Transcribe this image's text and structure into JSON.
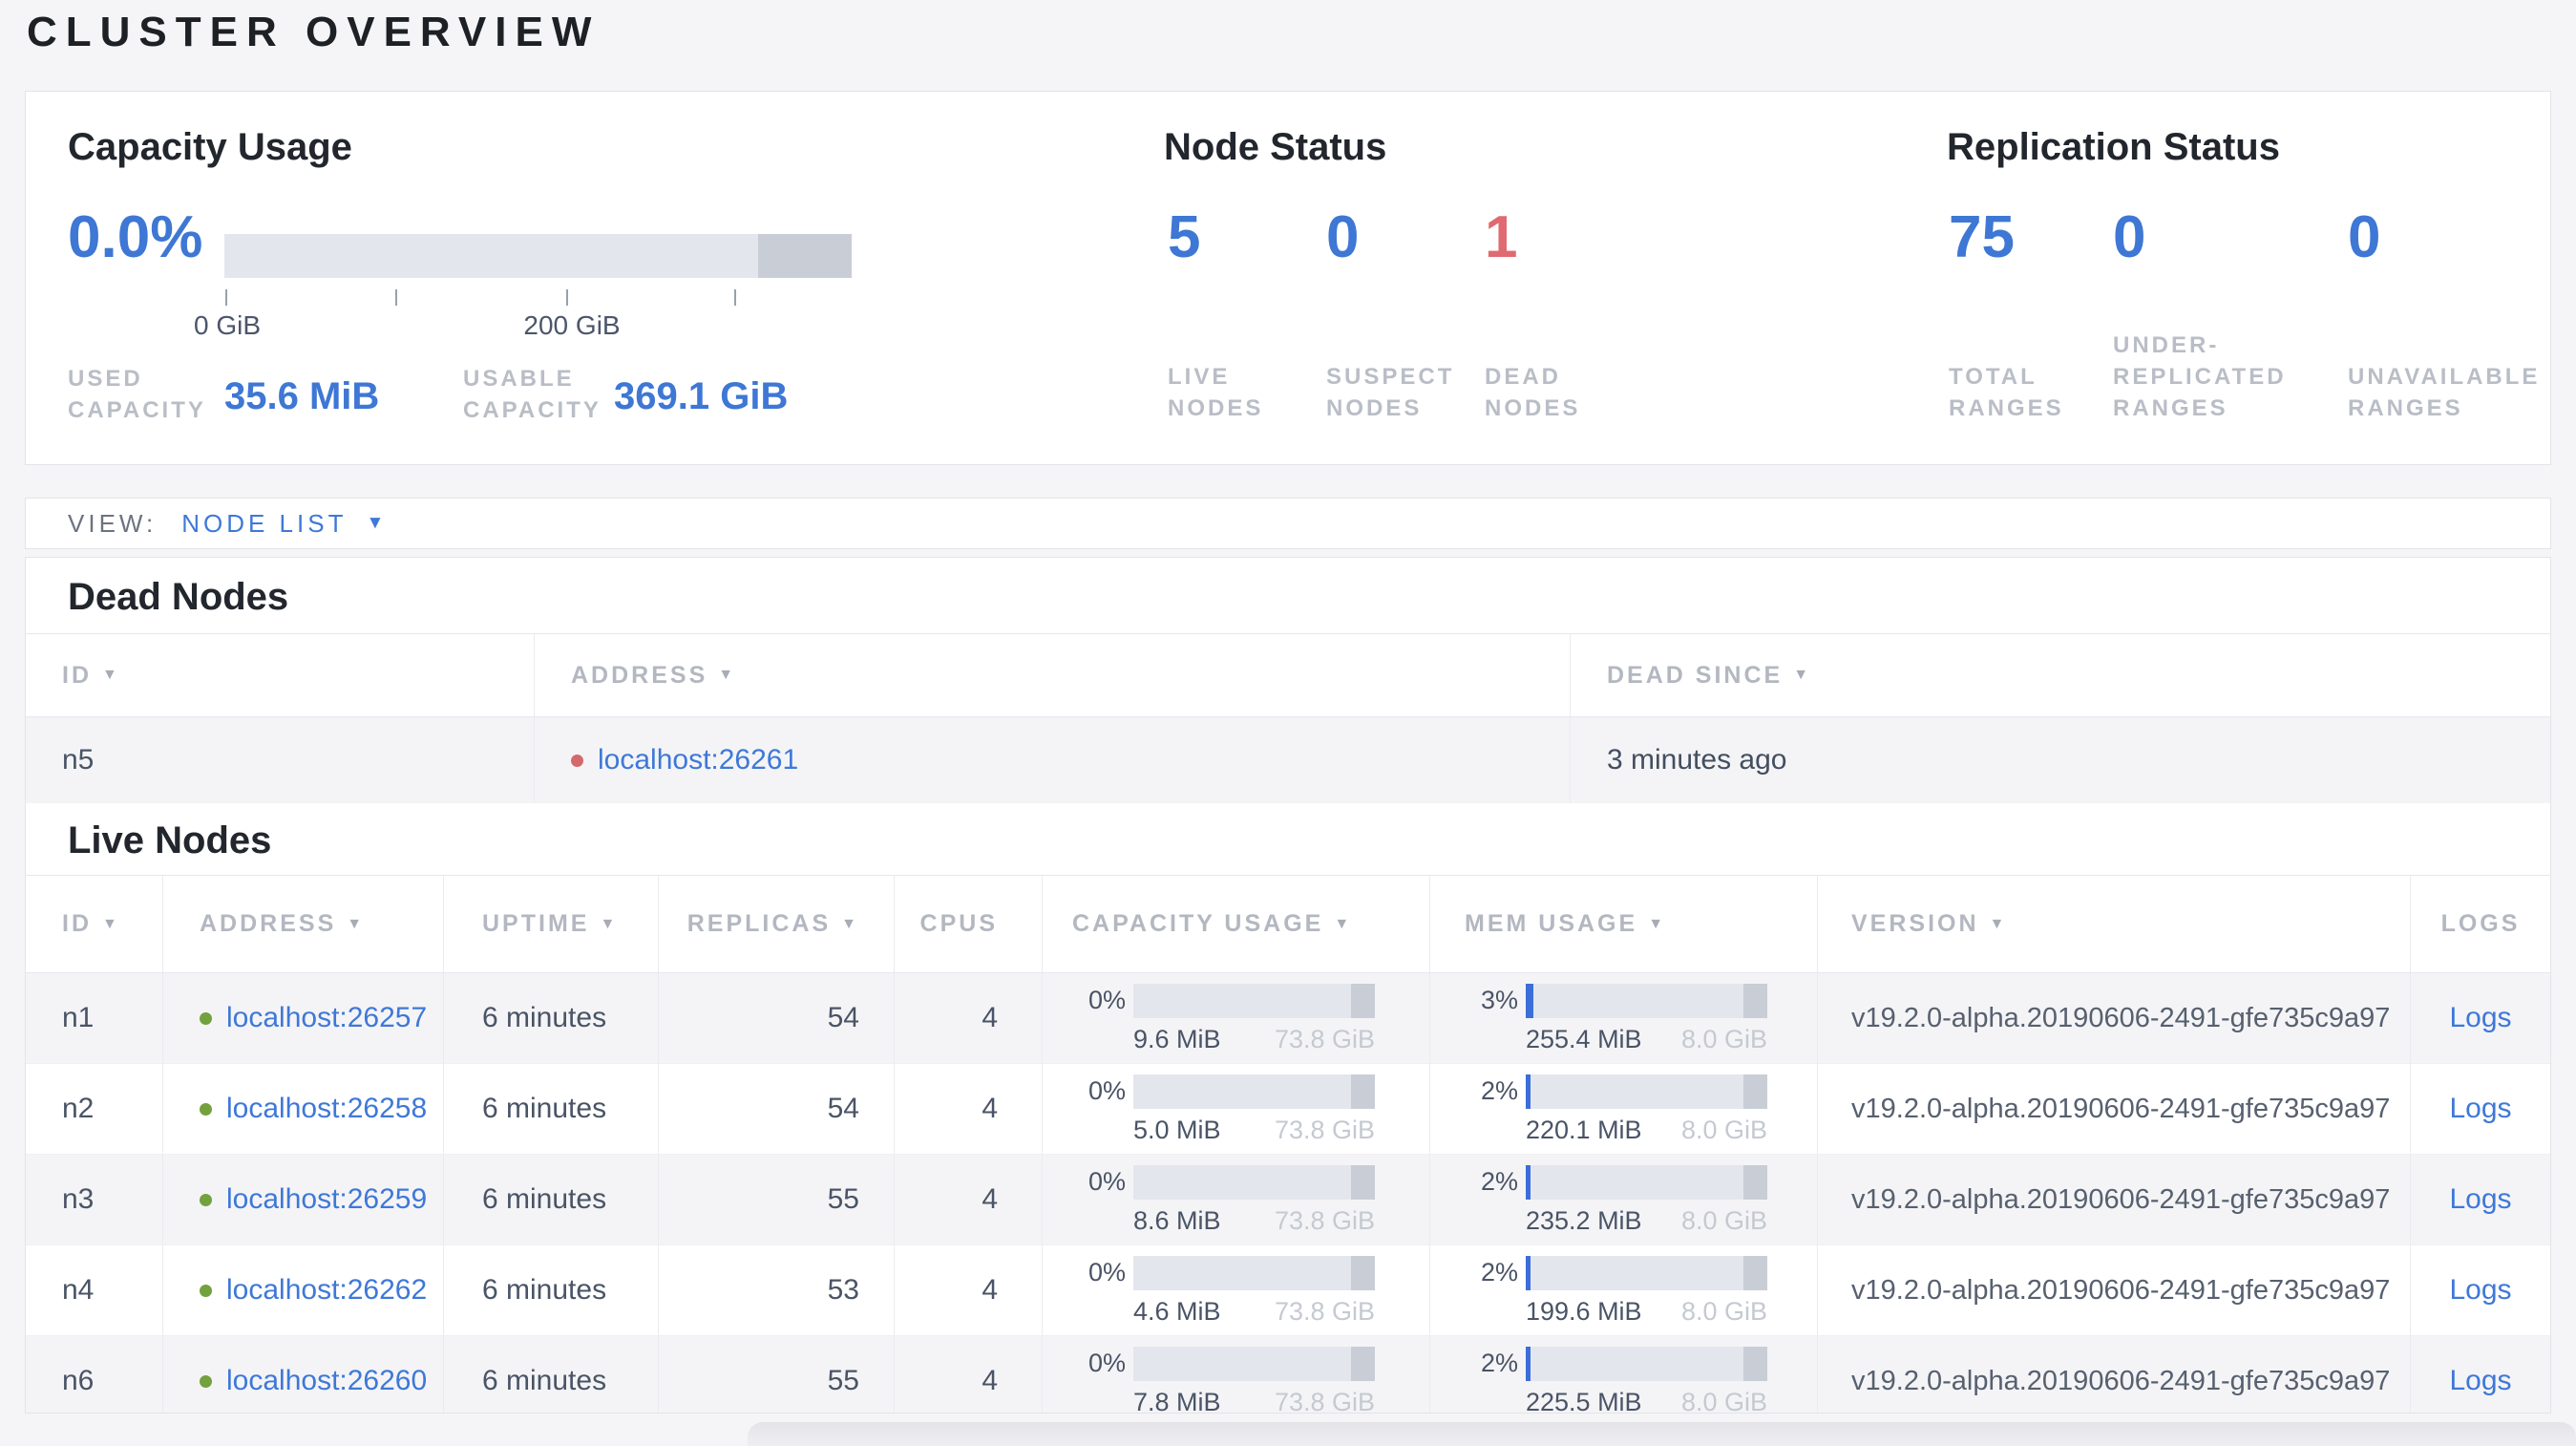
{
  "colors": {
    "accent_blue": "#3e77d4",
    "danger_red": "#e06a71",
    "live_dot_green": "#73a13d",
    "dead_dot_red": "#d4696b",
    "bar_track": "#e4e6ee",
    "bar_reserved": "#c9cdd6",
    "bar_fill_blue": "#3c6ed9"
  },
  "page_title": "CLUSTER OVERVIEW",
  "summary": {
    "capacity_usage": {
      "title": "Capacity Usage",
      "percent": "0.0%",
      "tick_labels": [
        "0 GiB",
        "200 GiB"
      ],
      "used_label": "USED CAPACITY",
      "used_value": "35.6 MiB",
      "usable_label": "USABLE CAPACITY",
      "usable_value": "369.1 GiB"
    },
    "node_status": {
      "title": "Node Status",
      "stats": [
        {
          "value": "5",
          "label": "LIVE NODES"
        },
        {
          "value": "0",
          "label": "SUSPECT NODES"
        },
        {
          "value": "1",
          "label": "DEAD NODES"
        }
      ]
    },
    "replication_status": {
      "title": "Replication Status",
      "stats": [
        {
          "value": "75",
          "label": "TOTAL RANGES"
        },
        {
          "value": "0",
          "label": "UNDER-REPLICATED RANGES"
        },
        {
          "value": "0",
          "label": "UNAVAILABLE RANGES"
        }
      ]
    }
  },
  "view_bar": {
    "label": "VIEW:",
    "selected": "NODE LIST"
  },
  "dead_nodes": {
    "title": "Dead Nodes",
    "columns": [
      {
        "label": "ID",
        "sortable": true
      },
      {
        "label": "ADDRESS",
        "sortable": true
      },
      {
        "label": "DEAD SINCE",
        "sortable": true
      }
    ],
    "rows": [
      {
        "id": "n5",
        "address": "localhost:26261",
        "dead_since": "3 minutes ago"
      }
    ]
  },
  "live_nodes": {
    "title": "Live Nodes",
    "columns": [
      {
        "label": "ID",
        "sortable": true
      },
      {
        "label": "ADDRESS",
        "sortable": true
      },
      {
        "label": "UPTIME",
        "sortable": true
      },
      {
        "label": "REPLICAS",
        "sortable": true
      },
      {
        "label": "CPUS",
        "sortable": false
      },
      {
        "label": "CAPACITY USAGE",
        "sortable": true
      },
      {
        "label": "MEM USAGE",
        "sortable": true
      },
      {
        "label": "VERSION",
        "sortable": true
      },
      {
        "label": "LOGS",
        "sortable": false
      }
    ],
    "rows": [
      {
        "id": "n1",
        "address": "localhost:26257",
        "uptime": "6 minutes",
        "replicas": "54",
        "cpus": "4",
        "capacity_pct": "0%",
        "capacity_used": "9.6 MiB",
        "capacity_total": "73.8 GiB",
        "mem_pct": "3%",
        "mem_used": "255.4 MiB",
        "mem_total": "8.0 GiB",
        "version": "v19.2.0-alpha.20190606-2491-gfe735c9a97",
        "logs": "Logs"
      },
      {
        "id": "n2",
        "address": "localhost:26258",
        "uptime": "6 minutes",
        "replicas": "54",
        "cpus": "4",
        "capacity_pct": "0%",
        "capacity_used": "5.0 MiB",
        "capacity_total": "73.8 GiB",
        "mem_pct": "2%",
        "mem_used": "220.1 MiB",
        "mem_total": "8.0 GiB",
        "version": "v19.2.0-alpha.20190606-2491-gfe735c9a97",
        "logs": "Logs"
      },
      {
        "id": "n3",
        "address": "localhost:26259",
        "uptime": "6 minutes",
        "replicas": "55",
        "cpus": "4",
        "capacity_pct": "0%",
        "capacity_used": "8.6 MiB",
        "capacity_total": "73.8 GiB",
        "mem_pct": "2%",
        "mem_used": "235.2 MiB",
        "mem_total": "8.0 GiB",
        "version": "v19.2.0-alpha.20190606-2491-gfe735c9a97",
        "logs": "Logs"
      },
      {
        "id": "n4",
        "address": "localhost:26262",
        "uptime": "6 minutes",
        "replicas": "53",
        "cpus": "4",
        "capacity_pct": "0%",
        "capacity_used": "4.6 MiB",
        "capacity_total": "73.8 GiB",
        "mem_pct": "2%",
        "mem_used": "199.6 MiB",
        "mem_total": "8.0 GiB",
        "version": "v19.2.0-alpha.20190606-2491-gfe735c9a97",
        "logs": "Logs"
      },
      {
        "id": "n6",
        "address": "localhost:26260",
        "uptime": "6 minutes",
        "replicas": "55",
        "cpus": "4",
        "capacity_pct": "0%",
        "capacity_used": "7.8 MiB",
        "capacity_total": "73.8 GiB",
        "mem_pct": "2%",
        "mem_used": "225.5 MiB",
        "mem_total": "8.0 GiB",
        "version": "v19.2.0-alpha.20190606-2491-gfe735c9a97",
        "logs": "Logs"
      }
    ]
  }
}
